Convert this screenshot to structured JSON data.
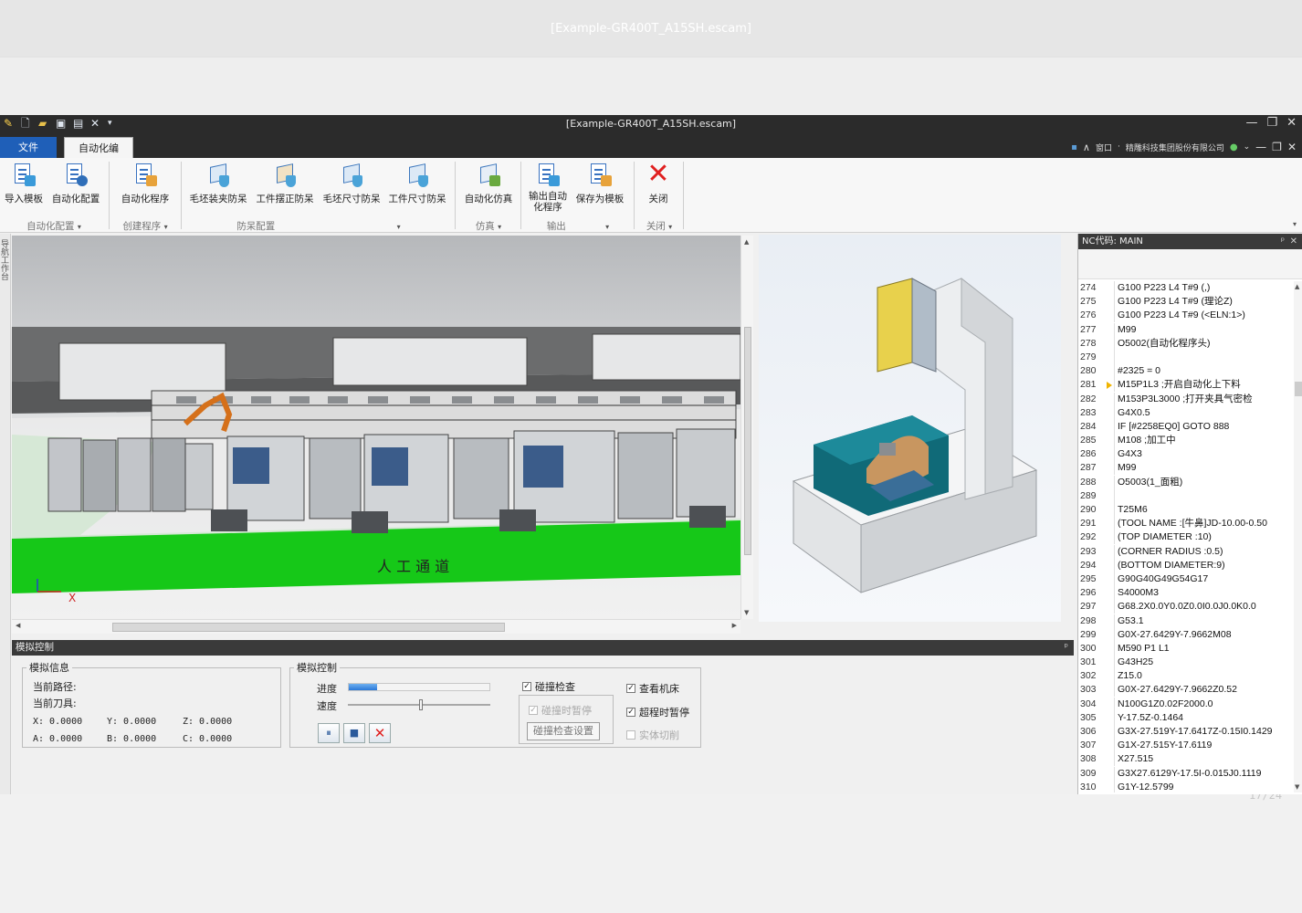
{
  "background": {
    "title": "[Example-GR400T_A15SH.escam]"
  },
  "window": {
    "title": "[Example-GR400T_A15SH.escam]"
  },
  "tabs": {
    "file": "文件",
    "automation": "自动化编程"
  },
  "account": {
    "window_menu": "窗口",
    "company": "精雕科技集团股份有限公司"
  },
  "ribbon": {
    "buttons": [
      {
        "label": "导入模板"
      },
      {
        "label": "自动化配置"
      },
      {
        "label": "自动化程序"
      },
      {
        "label": "毛坯装夹防呆"
      },
      {
        "label": "工件摆正防呆"
      },
      {
        "label": "毛坯尺寸防呆"
      },
      {
        "label": "工件尺寸防呆"
      },
      {
        "label": "自动化仿真"
      },
      {
        "label": "输出自动化程序"
      },
      {
        "label": "保存为模板"
      },
      {
        "label": "关闭"
      }
    ],
    "groups": [
      "自动化配置",
      "创建程序",
      "防呆配置",
      "仿真",
      "输出",
      "关闭"
    ]
  },
  "left_strip": "导航工作台",
  "viewport": {
    "floor_label": "人 工 通 道",
    "axis_x": "X"
  },
  "nc_panel": {
    "title": "NC代码: MAIN",
    "current_line": "281",
    "lines": [
      {
        "n": "274",
        "code": "G100 P223 L4 T#9 (,)"
      },
      {
        "n": "275",
        "code": "G100 P223 L4 T#9 (理论Z)"
      },
      {
        "n": "276",
        "code": "G100 P223 L4 T#9 (<ELN:1>)"
      },
      {
        "n": "277",
        "code": "M99"
      },
      {
        "n": "278",
        "code": "O5002(自动化程序头)"
      },
      {
        "n": "279",
        "code": ""
      },
      {
        "n": "280",
        "code": "#2325 = 0"
      },
      {
        "n": "281",
        "code": "M15P1L3                    ;开启自动化上下料"
      },
      {
        "n": "282",
        "code": "M153P3L3000             ;打开夹具气密检"
      },
      {
        "n": "283",
        "code": "G4X0.5"
      },
      {
        "n": "284",
        "code": "IF [#2258EQ0] GOTO 888"
      },
      {
        "n": "285",
        "code": "M108                          ;加工中"
      },
      {
        "n": "286",
        "code": "G4X3"
      },
      {
        "n": "287",
        "code": "M99"
      },
      {
        "n": "288",
        "code": "O5003(1_面粗)"
      },
      {
        "n": "289",
        "code": ""
      },
      {
        "n": "290",
        "code": "T25M6"
      },
      {
        "n": "291",
        "code": "(TOOL NAME      :[牛鼻]JD-10.00-0.50"
      },
      {
        "n": "292",
        "code": "(TOP DIAMETER   :10)"
      },
      {
        "n": "293",
        "code": "(CORNER RADIUS  :0.5)"
      },
      {
        "n": "294",
        "code": "(BOTTOM DIAMETER:9)"
      },
      {
        "n": "295",
        "code": "G90G40G49G54G17"
      },
      {
        "n": "296",
        "code": "S4000M3"
      },
      {
        "n": "297",
        "code": "G68.2X0.0Y0.0Z0.0I0.0J0.0K0.0"
      },
      {
        "n": "298",
        "code": "G53.1"
      },
      {
        "n": "299",
        "code": "G0X-27.6429Y-7.9662M08"
      },
      {
        "n": "300",
        "code": "M590 P1 L1"
      },
      {
        "n": "301",
        "code": "G43H25"
      },
      {
        "n": "302",
        "code": "Z15.0"
      },
      {
        "n": "303",
        "code": "G0X-27.6429Y-7.9662Z0.52"
      },
      {
        "n": "304",
        "code": "N100G1Z0.02F2000.0"
      },
      {
        "n": "305",
        "code": "Y-17.5Z-0.1464"
      },
      {
        "n": "306",
        "code": "G3X-27.519Y-17.6417Z-0.15I0.1429"
      },
      {
        "n": "307",
        "code": "G1X-27.515Y-17.6119"
      },
      {
        "n": "308",
        "code": "X27.515"
      },
      {
        "n": "309",
        "code": "G3X27.6129Y-17.5I-0.015J0.1119"
      },
      {
        "n": "310",
        "code": "G1Y-12.5799"
      }
    ]
  },
  "sim": {
    "title": "模拟控制",
    "info": {
      "legend": "模拟信息",
      "path_label": "当前路径:",
      "tool_label": "当前刀具:",
      "x": "X: 0.0000",
      "y": "Y: 0.0000",
      "z": "Z: 0.0000",
      "a": "A: 0.0000",
      "b": "B: 0.0000",
      "c": "C: 0.0000"
    },
    "control": {
      "legend": "模拟控制",
      "progress_label": "进度",
      "speed_label": "速度",
      "progress_value": 0.2,
      "speed_value": 0.5,
      "collision_check": "碰撞检查",
      "collision_pause": "碰撞时暂停",
      "collision_settings": "碰撞检查设置",
      "view_machine": "查看机床",
      "overtravel_pause": "超程时暂停",
      "solid_cut": "实体切削"
    }
  },
  "page_indicator": "17/24",
  "colors": {
    "accent": "#1f5fb8",
    "dark_bar": "#2b2b2b",
    "close_red": "#e02020",
    "floor_green": "#16c818"
  }
}
